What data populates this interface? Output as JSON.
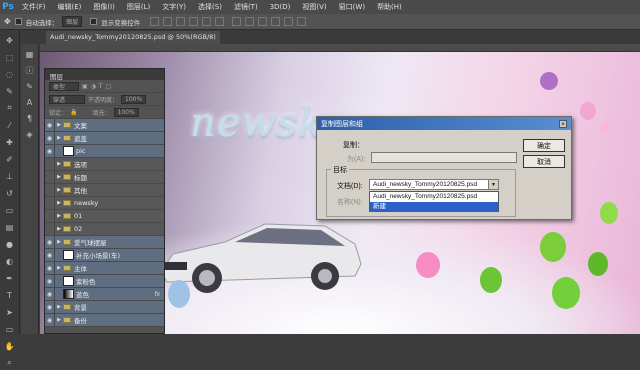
{
  "app": {
    "logo": "Ps"
  },
  "menu": [
    "文件(F)",
    "编辑(E)",
    "图像(I)",
    "图层(L)",
    "文字(Y)",
    "选择(S)",
    "滤镜(T)",
    "3D(D)",
    "视图(V)",
    "窗口(W)",
    "帮助(H)"
  ],
  "options": {
    "auto_select_label": "自动选择：",
    "auto_select_value": "图层",
    "show_transform_label": "显示变换控件"
  },
  "document_tab": "Audi_newsky_Tommy20120825.psd @ 50%(RGB/8)",
  "canvas": {
    "artwork_text": "newsk"
  },
  "layers_panel": {
    "title": "图层",
    "kind_filter": "类型",
    "blend_mode": "穿透",
    "opacity_label": "不透明度：",
    "opacity_value": "100%",
    "lock_label": "锁定：",
    "fill_label": "填充：",
    "fill_value": "100%",
    "layers": [
      {
        "name": "文案",
        "type": "folder",
        "visible": true
      },
      {
        "name": "遮盖",
        "type": "folder",
        "visible": true
      },
      {
        "name": "pic",
        "type": "image",
        "visible": true
      },
      {
        "name": "选项",
        "type": "folder",
        "visible": false
      },
      {
        "name": "标题",
        "type": "folder",
        "visible": false
      },
      {
        "name": "其他",
        "type": "folder",
        "visible": false
      },
      {
        "name": "newsky",
        "type": "folder",
        "visible": false
      },
      {
        "name": "01",
        "type": "folder",
        "visible": false
      },
      {
        "name": "02",
        "type": "folder",
        "visible": false
      },
      {
        "name": "爱气球摆屋",
        "type": "folder",
        "visible": true
      },
      {
        "name": "补充小场景(车)",
        "type": "mask",
        "visible": true
      },
      {
        "name": "主体",
        "type": "folder",
        "visible": true
      },
      {
        "name": "紫粉色",
        "type": "mask",
        "visible": true
      },
      {
        "name": "蓝色",
        "type": "gradient",
        "visible": true,
        "fx": "fx"
      },
      {
        "name": "背景",
        "type": "folder",
        "visible": true
      },
      {
        "name": "备份",
        "type": "folder",
        "visible": true
      }
    ]
  },
  "dialog": {
    "title": "复制图层和组",
    "copy_label": "复制：",
    "as_label": "为(A):",
    "target_label": "目标",
    "document_label": "文档(D):",
    "document_value": "Audi_newsky_Tommy20120825.psd",
    "name_label": "名称(N):",
    "dropdown_options": [
      "Audi_newsky_Tommy20120825.psd",
      "新建"
    ],
    "ok_button": "确定",
    "cancel_button": "取消"
  },
  "colors": {
    "accent": "#2b60c8",
    "layer_selected": "#5e6e80",
    "ps_blue": "#31a8ff"
  }
}
